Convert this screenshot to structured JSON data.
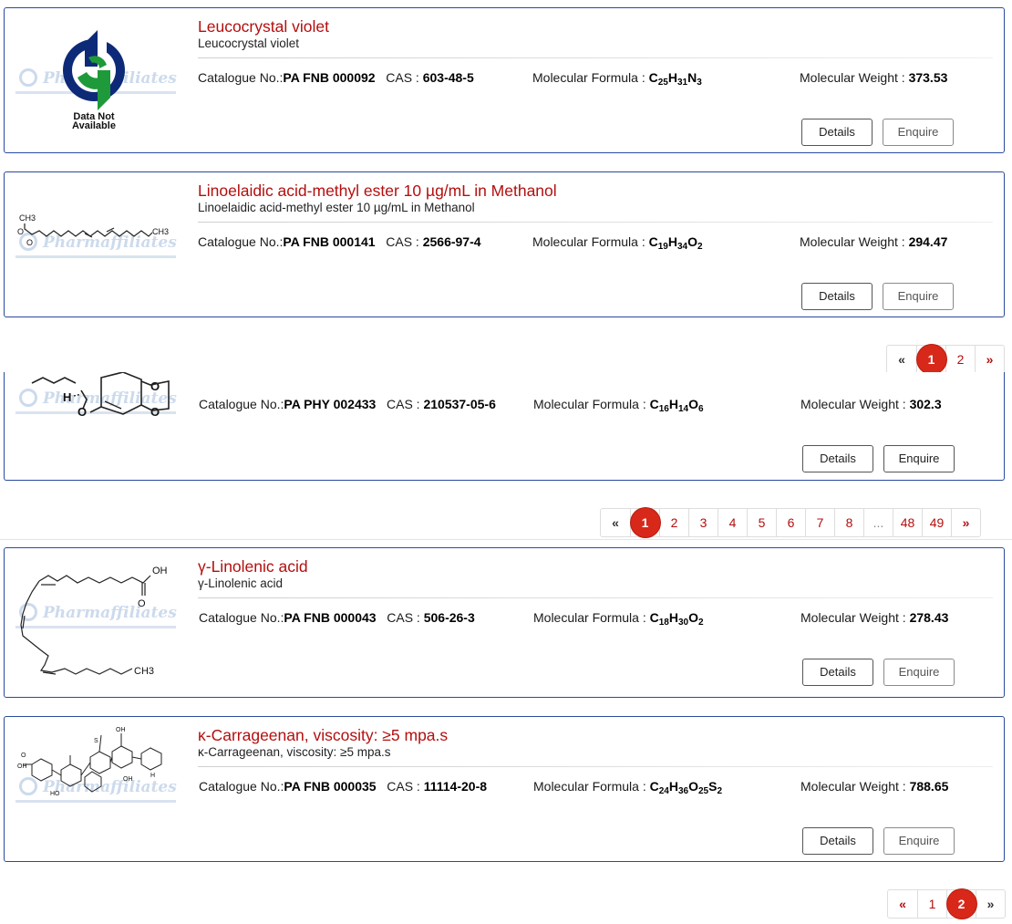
{
  "labels": {
    "catalogue": "Catalogue No.:",
    "cas": "CAS :",
    "formula": "Molecular Formula :",
    "weight": "Molecular Weight :",
    "details": "Details",
    "enquire": "Enquire"
  },
  "watermark": "Pharmaffiliates",
  "placeholder_image": {
    "line1": "Data Not",
    "line2": "Available"
  },
  "products": [
    {
      "title": "Leucocrystal violet",
      "subtitle": "Leucocrystal violet",
      "catalogue": "PA FNB 000092",
      "cas": "603-48-5",
      "formula": [
        [
          "C",
          "25"
        ],
        [
          "H",
          "31"
        ],
        [
          "N",
          "3"
        ]
      ],
      "weight": "373.53"
    },
    {
      "title": "Linoelaidic acid-methyl ester 10 µg/mL in Methanol",
      "subtitle": "Linoelaidic acid-methyl ester 10 µg/mL in Methanol",
      "catalogue": "PA FNB 000141",
      "cas": "2566-97-4",
      "formula": [
        [
          "C",
          "19"
        ],
        [
          "H",
          "34"
        ],
        [
          "O",
          "2"
        ]
      ],
      "weight": "294.47",
      "structure_labels": [
        "CH3",
        "O",
        "O",
        "CH3"
      ]
    },
    {
      "title": "",
      "subtitle": "",
      "catalogue": "PA PHY 002433",
      "cas": "210537-05-6",
      "formula": [
        [
          "C",
          "16"
        ],
        [
          "H",
          "14"
        ],
        [
          "O",
          "6"
        ]
      ],
      "weight": "302.3",
      "structure_labels": [
        "H",
        "O",
        "O",
        "O"
      ]
    },
    {
      "title": "γ-Linolenic acid",
      "subtitle": "γ-Linolenic acid",
      "catalogue": "PA FNB 000043",
      "cas": "506-26-3",
      "formula": [
        [
          "C",
          "18"
        ],
        [
          "H",
          "30"
        ],
        [
          "O",
          "2"
        ]
      ],
      "weight": "278.43",
      "structure_labels": [
        "OH",
        "O",
        "CH3"
      ]
    },
    {
      "title": "κ-Carrageenan, viscosity: ≥5 mpa.s",
      "subtitle": "κ-Carrageenan, viscosity: ≥5 mpa.s",
      "catalogue": "PA FNB 000035",
      "cas": "11114-20-8",
      "formula": [
        [
          "C",
          "24"
        ],
        [
          "H",
          "36"
        ],
        [
          "O",
          "25"
        ],
        [
          "S",
          "2"
        ]
      ],
      "weight": "788.65",
      "structure_labels": [
        "OH",
        "O",
        "S",
        "OH",
        "HO",
        "OH",
        "H"
      ]
    }
  ],
  "pagers": [
    {
      "prev": "«",
      "next": "»",
      "pages": [
        "1",
        "2"
      ],
      "active": "1"
    },
    {
      "prev": "«",
      "next": "»",
      "pages": [
        "1",
        "2",
        "3",
        "4",
        "5",
        "6",
        "7",
        "8",
        "...",
        "48",
        "49"
      ],
      "active": "1"
    },
    {
      "prev": "«",
      "next": "»",
      "pages": [
        "1",
        "2"
      ],
      "active": "2"
    }
  ],
  "colors": {
    "title_red": "#b30f0f",
    "card_border": "#2a4aa0",
    "active_page": "#d7281a"
  }
}
